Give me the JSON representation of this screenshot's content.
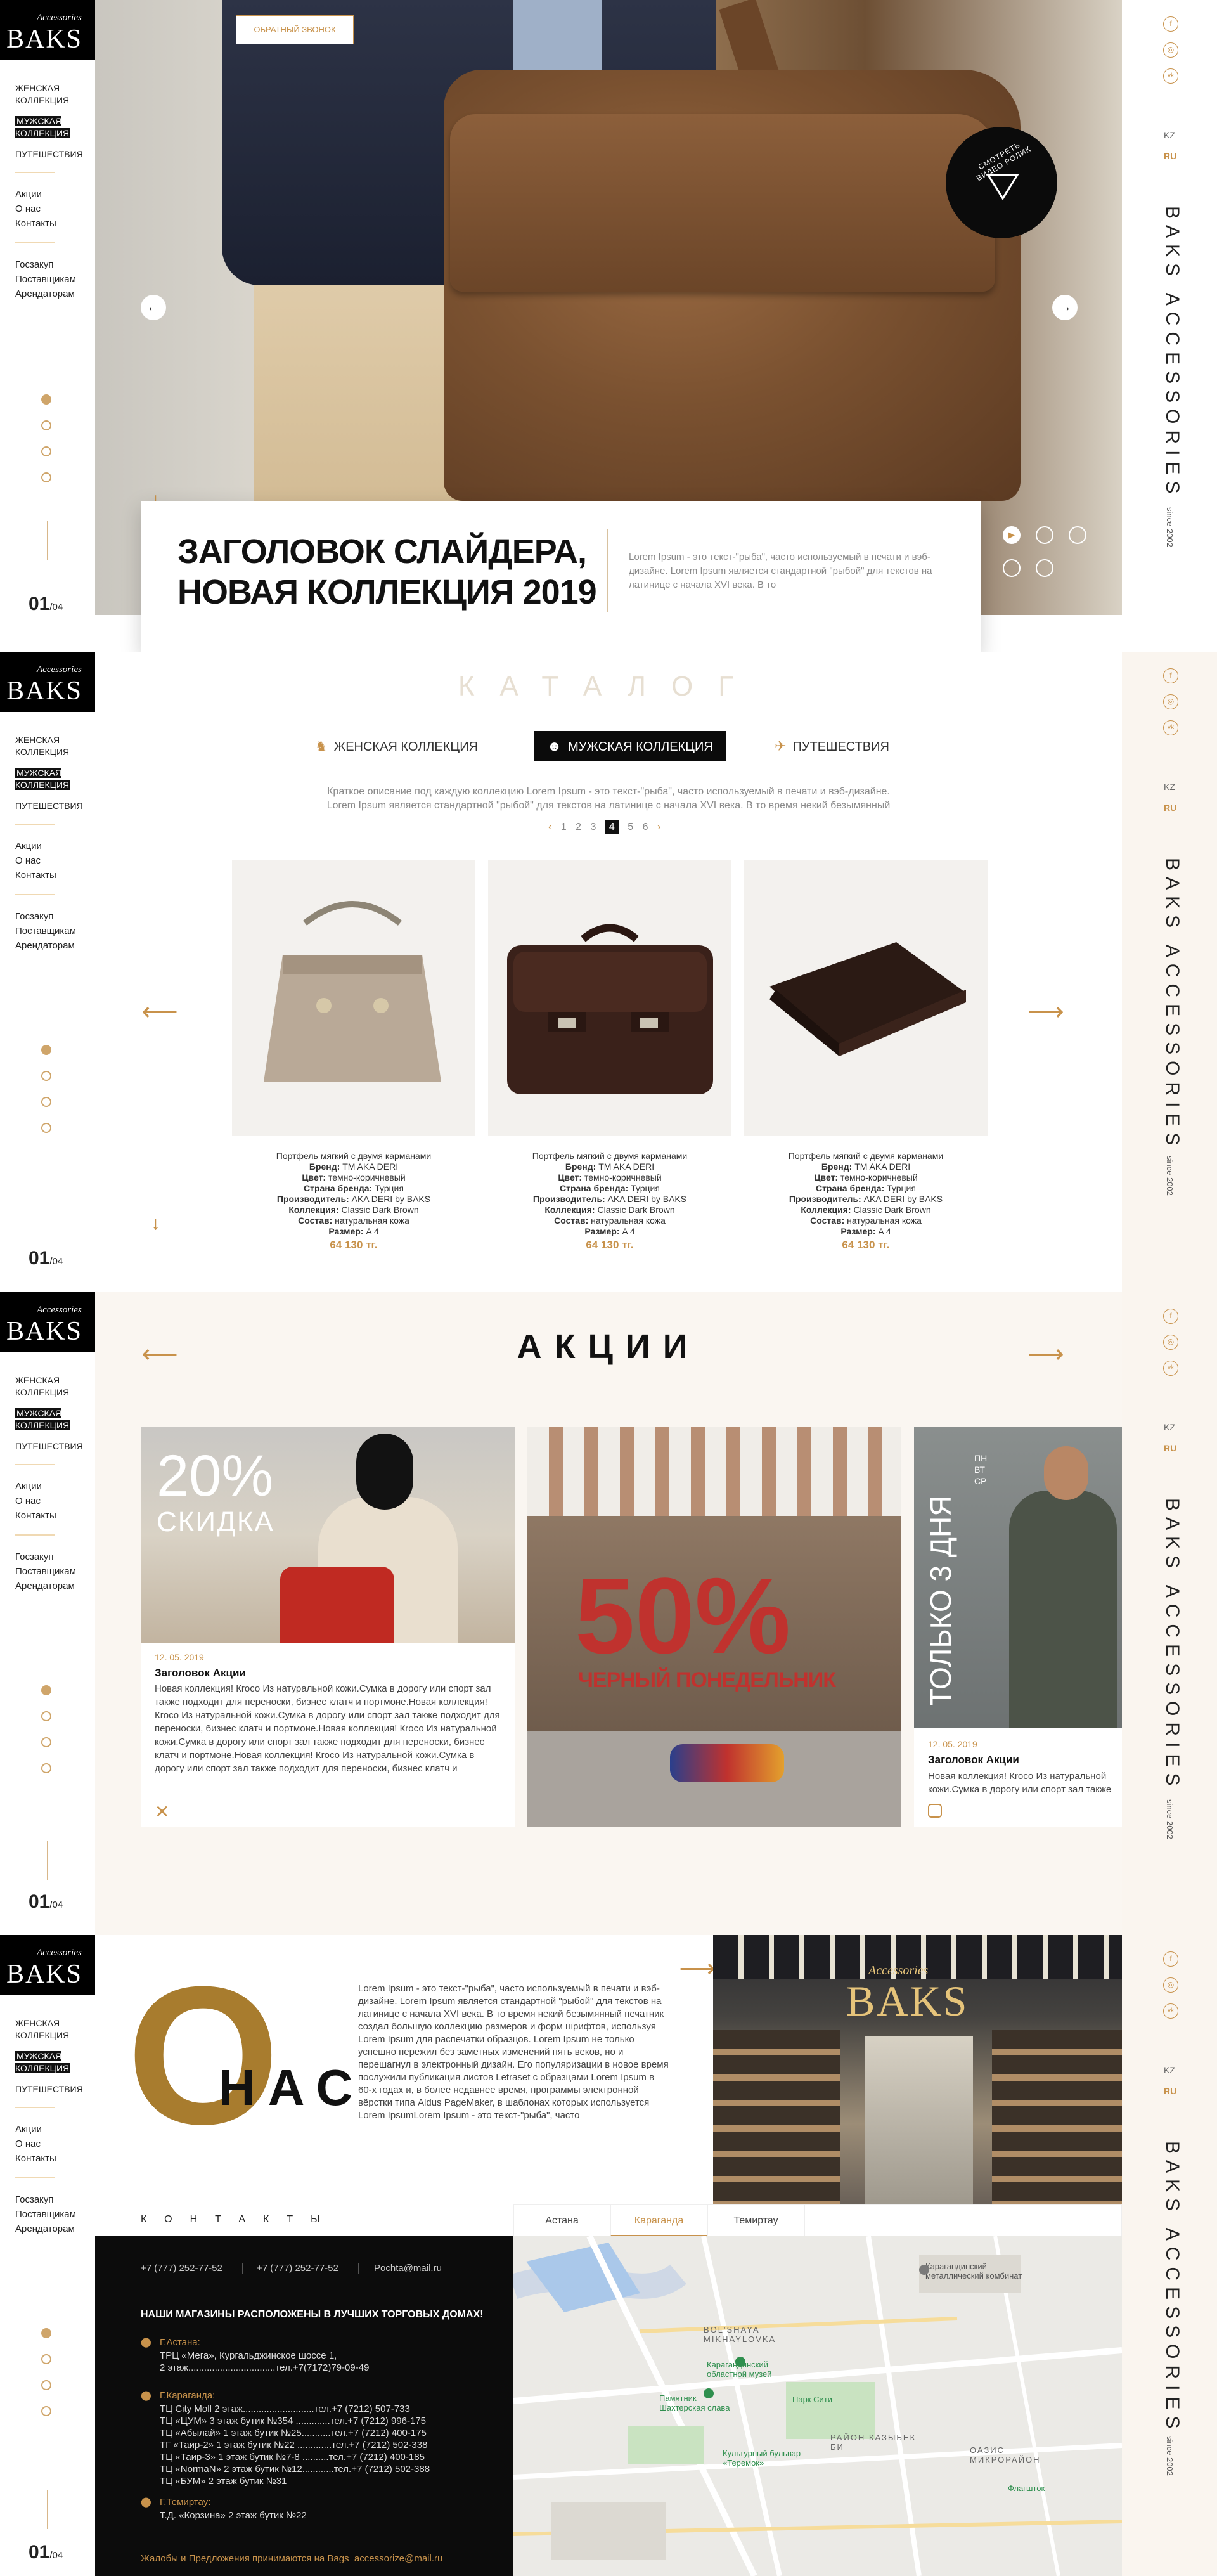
{
  "brand": {
    "logo_small": "Accessories",
    "logo_big": "BAKS"
  },
  "sidebar": {
    "nav": [
      "ЖЕНСКАЯ КОЛЛЕКЦИЯ",
      "МУЖСКАЯ КОЛЛЕКЦИЯ",
      "ПУТЕШЕСТВИЯ"
    ],
    "links": [
      "Акции",
      "О нас",
      "Контакты"
    ],
    "links2": [
      "Госзакуп",
      "Поставщикам",
      "Арендаторам"
    ],
    "pager_current": "01",
    "pager_total": "/04"
  },
  "right_sidebar": {
    "social": [
      "f",
      "◎",
      "vk"
    ],
    "languages": [
      "KZ",
      "RU"
    ],
    "active_language": "RU",
    "brand_vertical": "BAKS ACCESSORIES",
    "since": "since 2002"
  },
  "hero": {
    "callback": "Обратный звонок",
    "video": "СМОТРЕТЬ ВИДЕО РОЛИК",
    "title": "Заголовок слайдера, новая коллекция 2019",
    "desc": "Lorem Ipsum - это текст-\"рыба\", часто используемый в печати и вэб-дизайне. Lorem Ipsum является стандартной \"рыбой\" для текстов на латинице с начала XVI века. В то"
  },
  "catalog": {
    "title": "КАТАЛОГ",
    "tabs": [
      "ЖЕНСКАЯ КОЛЛЕКЦИЯ",
      "МУЖСКАЯ КОЛЛЕКЦИЯ",
      "ПУТЕШЕСТВИЯ"
    ],
    "active_tab": "МУЖСКАЯ КОЛЛЕКЦИЯ",
    "desc": "Краткое описание под каждую коллекцию Lorem Ipsum - это текст-\"рыба\", часто используемый в печати и вэб-дизайне. Lorem Ipsum является стандартной \"рыбой\" для текстов на латинице с начала XVI века. В то время некий безымянный",
    "pages": [
      "1",
      "2",
      "3",
      "4",
      "5",
      "6"
    ],
    "current_page": "4",
    "products": [
      {
        "name": "Портфель мягкий с двумя карманами",
        "brand_label": "Бренд:",
        "brand": "TM AKA DERI",
        "color_label": "Цвет:",
        "color": "темно-коричневый",
        "country_label": "Страна бренда:",
        "country": "Турция",
        "maker_label": "Производитель:",
        "maker": "AKA DERI by BAKS",
        "collection_label": "Коллекция:",
        "collection": "Classic Dark Brown",
        "material_label": "Состав:",
        "material": "натуральная кожа",
        "size_label": "Размер:",
        "size": "A 4",
        "price": "64 130 тг."
      },
      {
        "name": "Портфель мягкий с двумя карманами",
        "brand_label": "Бренд:",
        "brand": "TM AKA DERI",
        "color_label": "Цвет:",
        "color": "темно-коричневый",
        "country_label": "Страна бренда:",
        "country": "Турция",
        "maker_label": "Производитель:",
        "maker": "AKA DERI by BAKS",
        "collection_label": "Коллекция:",
        "collection": "Classic Dark Brown",
        "material_label": "Состав:",
        "material": "натуральная кожа",
        "size_label": "Размер:",
        "size": "A 4",
        "price": "64 130 тг."
      },
      {
        "name": "Портфель мягкий с двумя карманами",
        "brand_label": "Бренд:",
        "brand": "TM AKA DERI",
        "color_label": "Цвет:",
        "color": "темно-коричневый",
        "country_label": "Страна бренда:",
        "country": "Турция",
        "maker_label": "Производитель:",
        "maker": "AKA DERI by BAKS",
        "collection_label": "Коллекция:",
        "collection": "Classic Dark Brown",
        "material_label": "Состав:",
        "material": "натуральная кожа",
        "size_label": "Размер:",
        "size": "A 4",
        "price": "64 130 тг."
      }
    ]
  },
  "promo": {
    "title": "АКЦИИ",
    "card1": {
      "big": "20%",
      "sub": "СКИДКА",
      "date": "12. 05. 2019",
      "title": "Заголовок Акции",
      "text": "Новая коллекция! Кrосо Из натуральной кожи.Сумка в дорогу или спорт зал также подходит для переноски, бизнес клатч и портмоне.Новая коллекция! Кrосо Из натуральной кожи.Сумка в дорогу или спорт зал также подходит для переноски, бизнес клатч и портмоне.Новая коллекция! Кrосо Из натуральной кожи.Сумка в дорогу или спорт зал также подходит для переноски, бизнес клатч и портмоне.Новая коллекция! Кrосо Из натуральной кожи.Сумка в дорогу или спорт зал также подходит для переноски, бизнес клатч и"
    },
    "card2": {
      "big": "50%",
      "sub": "ЧЕРНЫЙ ПОНЕДЕЛЬНИК"
    },
    "card3": {
      "big": "ТОЛЬКО 3 ДНЯ",
      "days": "ПН ВТ СР",
      "date": "12. 05. 2019",
      "title": "Заголовок Акции",
      "text": "Новая коллекция! Кrосо Из натуральной кожи.Сумка в дорогу или спорт зал также подходит для переноски,"
    }
  },
  "about": {
    "big": "О",
    "title": "НАС",
    "text": "Lorem Ipsum - это текст-\"рыба\", часто используемый в печати и вэб-дизайне. Lorem Ipsum является стандартной \"рыбой\" для текстов на латинице с начала XVI века. В то время некий безымянный печатник создал большую коллекцию размеров и форм шрифтов, используя Lorem Ipsum для распечатки образцов. Lorem Ipsum не только успешно пережил без заметных изменений пять веков, но и перешагнул в электронный дизайн. Его популяризации в новое время послужили публикация листов Letraset с образцами Lorem Ipsum в 60-х годах и, в более недавнее время, программы электронной вёрстки типа Aldus PageMaker, в шаблонах которых используется Lorem IpsumLorem Ipsum - это текст-\"рыба\", часто",
    "store_sign_small": "Accessories",
    "store_sign": "BAKS"
  },
  "contacts": {
    "title": "КОНТАКТЫ",
    "cities": [
      "Астана",
      "Караганда",
      "Темиртау"
    ],
    "active_city": "Караганда",
    "phone1": "+7 (777) 252-77-52",
    "phone2": "+7 (777) 252-77-52",
    "email": "Pochta@mail.ru",
    "stores_heading": "НАШИ МАГАЗИНЫ РАСПОЛОЖЕНЫ В ЛУЧШИХ ТОРГОВЫХ ДОМАХ!",
    "astana_name": "Г.Астана:",
    "astana_lines": [
      "ТРЦ «Мега», Кургальджинское шоссе 1,",
      "2 этаж.................................тел.+7(7172)79-09-49"
    ],
    "karaganda_name": "Г.Караганда:",
    "karaganda_lines": [
      "ТЦ City Moll 2 этаж...........................тел.+7 (7212) 507-733",
      "ТЦ «ЦУМ» 3 этаж бутик №354 .............тел.+7 (7212) 996-175",
      "ТЦ «Абылай» 1 этаж бутик №25...........тел.+7 (7212) 400-175",
      "ТГ «Таир-2» 1 этаж бутик №22 .............тел.+7 (7212) 502-338",
      "ТЦ «Таир-3» 1 этаж бутик №7-8 ..........тел.+7 (7212) 400-185",
      "ТЦ «NormaN» 2 этаж бутик №12............тел.+7 (7212) 502-388",
      "ТЦ «БУМ» 2 этаж бутик №31"
    ],
    "temirtau_name": "Г.Темиртау:",
    "temirtau_lines": [
      "Т.Д. «Корзина» 2 этаж бутик №22"
    ],
    "footer": "Жалобы и Предложения принимаются на Bags_accessorize@mail.ru"
  },
  "map": {
    "labels": [
      "Карагандинский металлический комбинат",
      "BOL'SHAYA MIKHAYLOVKA",
      "Карагандинский областной музей",
      "Памятник Шахтерская слава",
      "Парк Сити",
      "РАЙОН КАЗЫБЕК БИ",
      "ОАЗИС МИКРОРАЙОН",
      "Культурный бульвар «Теремок»",
      "Флагшток"
    ]
  }
}
